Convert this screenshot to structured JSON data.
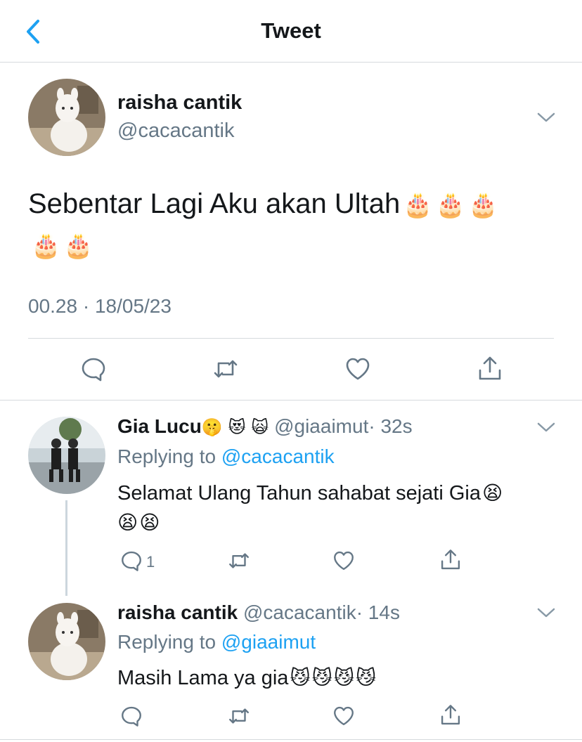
{
  "header": {
    "title": "Tweet",
    "back_icon": "chevron-left-icon",
    "accent": "#1da1f2"
  },
  "main_tweet": {
    "display_name": "raisha cantik",
    "handle": "@cacacantik",
    "text": "Sebentar Lagi Aku akan Ultah",
    "emojis": [
      "🎂",
      "🎂",
      "🎂",
      "🎂",
      "🎂"
    ],
    "timestamp": "00.28 · 18/05/23",
    "actions": [
      "reply-icon",
      "retweet-icon",
      "like-icon",
      "share-icon"
    ]
  },
  "replies": [
    {
      "display_name": "Gia Lucu",
      "name_emojis": [
        "🤫",
        "😻",
        "🙀"
      ],
      "handle": "@giaaimut",
      "time": "· 32s",
      "replying_prefix": "Replying to",
      "replying_to": "@cacacantik",
      "text": "Selamat Ulang Tahun sahabat sejati Gia",
      "emojis": [
        "😫",
        "😫",
        "😫"
      ],
      "reply_count": "1"
    },
    {
      "display_name": "raisha cantik",
      "handle": "@cacacantik",
      "time": "· 14s",
      "replying_prefix": "Replying to",
      "replying_to": "@giaaimut",
      "text": "Masih Lama ya gia",
      "emojis": [
        "😼",
        "😼",
        "😼",
        "😼"
      ]
    }
  ]
}
